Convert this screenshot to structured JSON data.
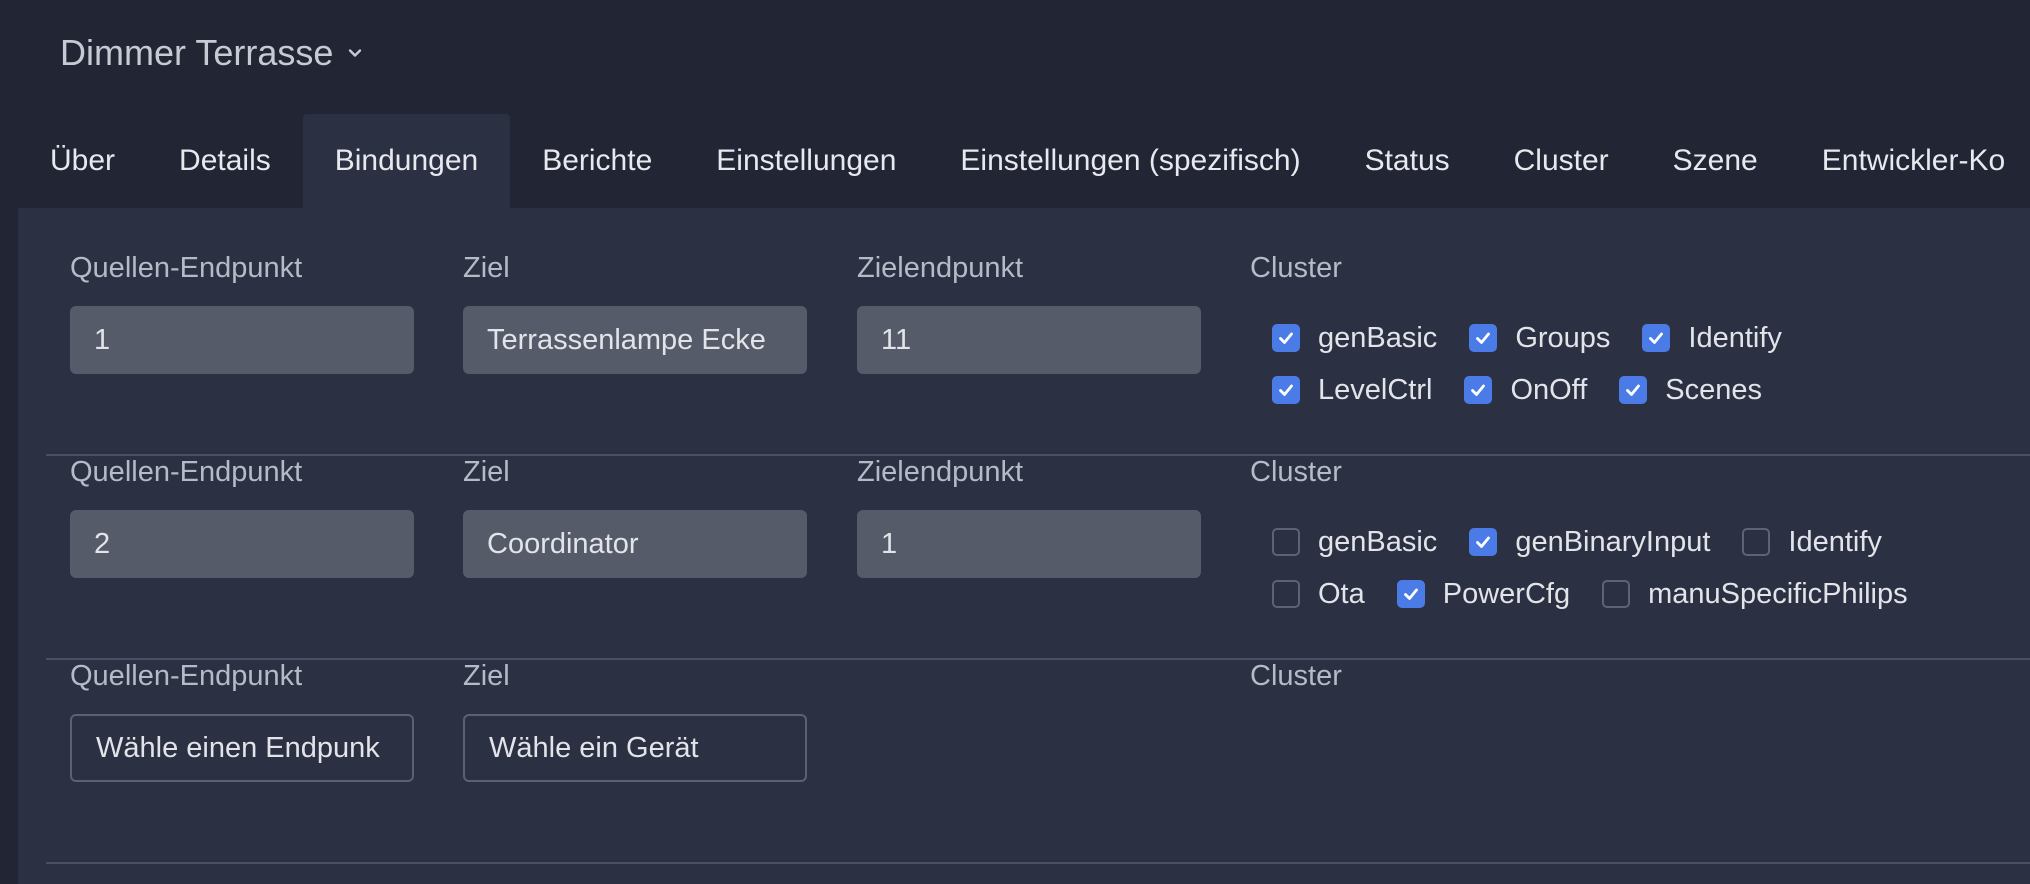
{
  "device": {
    "name": "Dimmer Terrasse",
    "chevron_icon": "chevron-down-icon"
  },
  "tabs": [
    {
      "label": "Über",
      "active": false
    },
    {
      "label": "Details",
      "active": false
    },
    {
      "label": "Bindungen",
      "active": true
    },
    {
      "label": "Berichte",
      "active": false
    },
    {
      "label": "Einstellungen",
      "active": false
    },
    {
      "label": "Einstellungen (spezifisch)",
      "active": false
    },
    {
      "label": "Status",
      "active": false
    },
    {
      "label": "Cluster",
      "active": false
    },
    {
      "label": "Szene",
      "active": false
    },
    {
      "label": "Entwickler-Ko",
      "active": false
    }
  ],
  "labels": {
    "source_endpoint": "Quellen-Endpunkt",
    "target": "Ziel",
    "target_endpoint": "Zielendpunkt",
    "cluster": "Cluster"
  },
  "bindings": [
    {
      "source_endpoint": "1",
      "target": "Terrassenlampe Ecke",
      "target_endpoint": "11",
      "clusters": [
        [
          {
            "name": "genBasic",
            "checked": true
          },
          {
            "name": "Groups",
            "checked": true
          },
          {
            "name": "Identify",
            "checked": true
          }
        ],
        [
          {
            "name": "LevelCtrl",
            "checked": true
          },
          {
            "name": "OnOff",
            "checked": true
          },
          {
            "name": "Scenes",
            "checked": true
          }
        ]
      ]
    },
    {
      "source_endpoint": "2",
      "target": "Coordinator",
      "target_endpoint": "1",
      "clusters": [
        [
          {
            "name": "genBasic",
            "checked": false
          },
          {
            "name": "genBinaryInput",
            "checked": true
          },
          {
            "name": "Identify",
            "checked": false
          }
        ],
        [
          {
            "name": "Ota",
            "checked": false
          },
          {
            "name": "PowerCfg",
            "checked": true
          },
          {
            "name": "manuSpecificPhilips",
            "checked": false
          }
        ]
      ]
    }
  ],
  "new_binding": {
    "source_placeholder": "Wähle einen Endpunk",
    "target_placeholder": "Wähle ein Gerät"
  },
  "colors": {
    "accent": "#4a7be6",
    "background": "#222634",
    "panel": "#2b3042"
  }
}
